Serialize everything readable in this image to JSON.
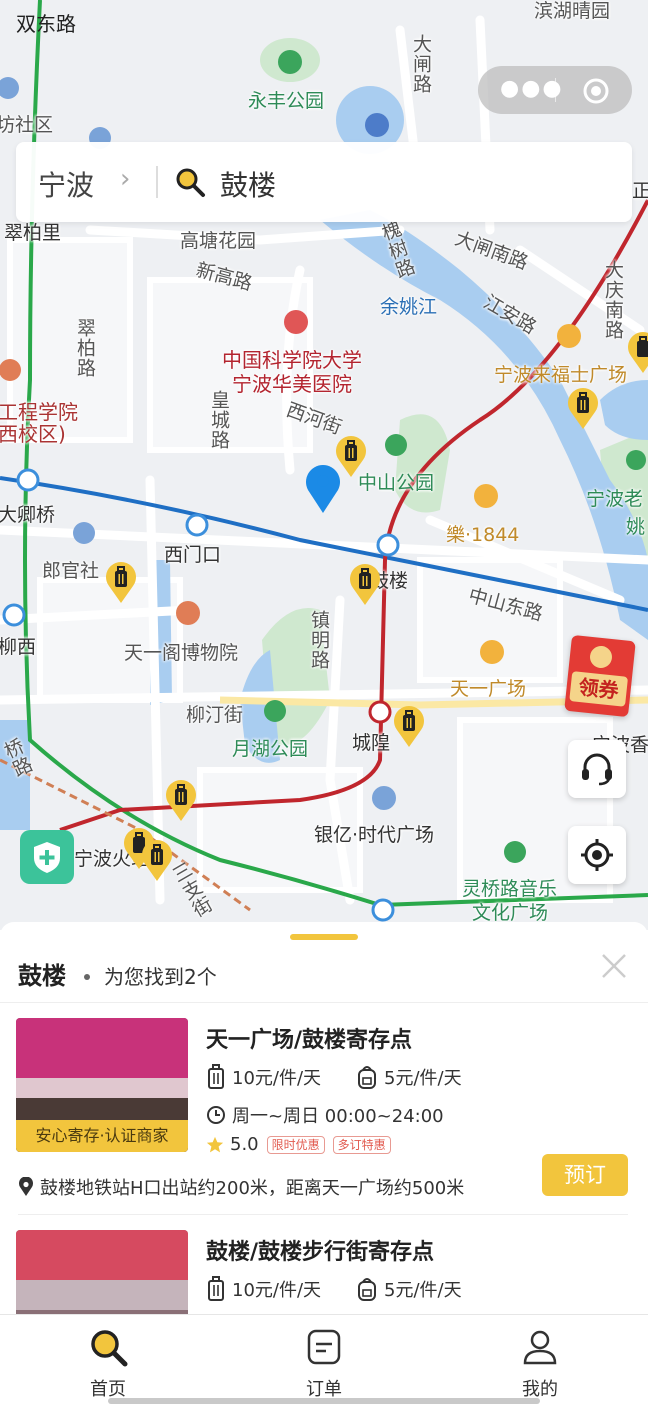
{
  "status_bar": {
    "time": "双东路"
  },
  "search": {
    "city": "宁波",
    "chevron": "›",
    "query": "鼓楼"
  },
  "map": {
    "labels": {
      "yongfeng_park": "永丰公园",
      "binhu": "滨湖晴园",
      "dazha_road": "大闸路",
      "fangshequ": "坊社区",
      "cuibaili": "翠柏里",
      "gaotang": "高塘花园",
      "xingao_road": "新高路",
      "jishu_road": "槐树路",
      "dazha_south": "大闸南路",
      "yuyao_river": "余姚江",
      "jiangan_road": "江安路",
      "daqing_south": "大庆南路",
      "zheng": "正",
      "hospital_line1": "中国科学院大学",
      "hospital_line2": "宁波华美医院",
      "raffles": "宁波来福士广场",
      "cuibai_road": "翠柏路",
      "engineering_1": "工程学院",
      "engineering_2": "西校区)",
      "xihe_street": "西河街",
      "huangcheng_road": "皇城路",
      "zhongshan_park": "中山公园",
      "le1844": "樂·1844",
      "ningbolao": "宁波老",
      "yao": "姚",
      "daqing_bridge": "大卿桥",
      "ximenkou": "西门口",
      "langguan": "郎官社",
      "gulou_map": "鼓楼",
      "zhongshan_east": "中山东路",
      "liuxi": "柳西",
      "tianyige": "天一阁博物院",
      "zhenming_road": "镇明路",
      "tianyi_square": "天一广场",
      "liuting_street": "柳汀街",
      "yuehu_park": "月湖公园",
      "chenghuang": "城隍",
      "ningbo_right": "宁波香",
      "qiao_road": "桥路",
      "yinyi": "银亿·时代广场",
      "ningbo_station": "宁波火站",
      "sanshiqi": "三支街",
      "lingqiao_1": "灵桥路音乐",
      "lingqiao_2": "文化广场"
    },
    "coupon_label": "领券"
  },
  "sheet": {
    "keyword": "鼓楼",
    "found_text": "为您找到2个",
    "results": [
      {
        "title": "天一广场/鼓楼寄存点",
        "luggage_price": "10元/件/天",
        "bag_price": "5元/件/天",
        "hours": "周一~周日 00:00~24:00",
        "rating": "5.0",
        "tags": [
          "限时优惠",
          "多订特惠"
        ],
        "badge": "安心寄存·认证商家",
        "address": "鼓楼地铁站H口出站约200米，距离天一广场约500米",
        "book_label": "预订"
      },
      {
        "title": "鼓楼/鼓楼步行街寄存点",
        "luggage_price": "10元/件/天",
        "bag_price": "5元/件/天"
      }
    ]
  },
  "tabbar": {
    "home": "首页",
    "orders": "订单",
    "mine": "我的"
  },
  "colors": {
    "accent": "#f2c53d",
    "metro_blue": "#1f6fc4",
    "metro_red": "#c0262d",
    "metro_green": "#2aa84a"
  }
}
